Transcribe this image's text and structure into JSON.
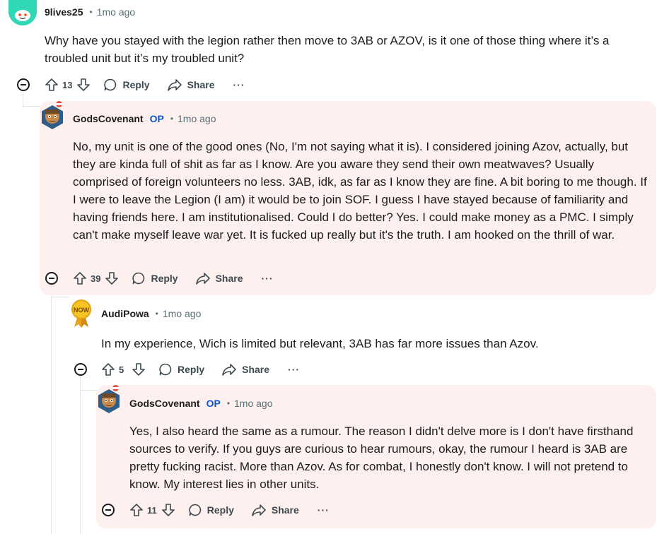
{
  "comments": [
    {
      "author": "9lives25",
      "time": "1mo ago",
      "separator": "•",
      "text": "Why have you stayed with the legion rather then move to 3AB or AZOV, is it one of those thing where it’s a troubled unit but it’s my troubled unit?",
      "votes": "13",
      "reply_label": "Reply",
      "share_label": "Share",
      "more_label": "···"
    },
    {
      "author": "GodsCovenant",
      "op_label": "OP",
      "time": "1mo ago",
      "separator": "•",
      "text": "No, my unit is one of the good ones (No, I'm not saying what it is). I considered joining Azov, actually, but they are kinda full of shit as far as I know. Are you aware they send their own meatwaves? Usually comprised of foreign volunteers no less. 3AB, idk, as far as I know they are fine. A bit boring to me though. If I were to leave the Legion (I am) it would be to join SOF. I guess I have stayed because of familiarity and having friends here. I am institutionalised. Could I do better? Yes. I could make money as a PMC. I simply can't make myself leave war yet. It is fucked up really but it's the truth. I am hooked on the thrill of war.",
      "votes": "39",
      "reply_label": "Reply",
      "share_label": "Share",
      "more_label": "···"
    },
    {
      "author": "AudiPowa",
      "time": "1mo ago",
      "separator": "•",
      "text": "In my experience, Wich is limited but relevant, 3AB has far more issues than Azov.",
      "votes": "5",
      "reply_label": "Reply",
      "share_label": "Share",
      "more_label": "···",
      "avatar_text": "NOW"
    },
    {
      "author": "GodsCovenant",
      "op_label": "OP",
      "time": "1mo ago",
      "separator": "•",
      "text": "Yes, I also heard the same as a rumour. The reason I didn't delve more is I don't have firsthand sources to verify. If you guys are curious to hear rumours, okay, the rumour I heard is 3AB are pretty fucking racist. More than Azov. As for combat, I honestly don't know. I will not pretend to know. My interest lies in other units.",
      "votes": "11",
      "reply_label": "Reply",
      "share_label": "Share",
      "more_label": "···"
    }
  ],
  "colors": {
    "op_highlight": "#fdf0ee",
    "op_tag": "#0a55c9",
    "meta_gray": "#576f76",
    "avatar_teal": "#2fd7b5"
  },
  "icons": [
    "upvote-icon",
    "downvote-icon",
    "reply-bubble-icon",
    "share-arrow-icon",
    "more-dots-icon",
    "collapse-minus-icon"
  ]
}
